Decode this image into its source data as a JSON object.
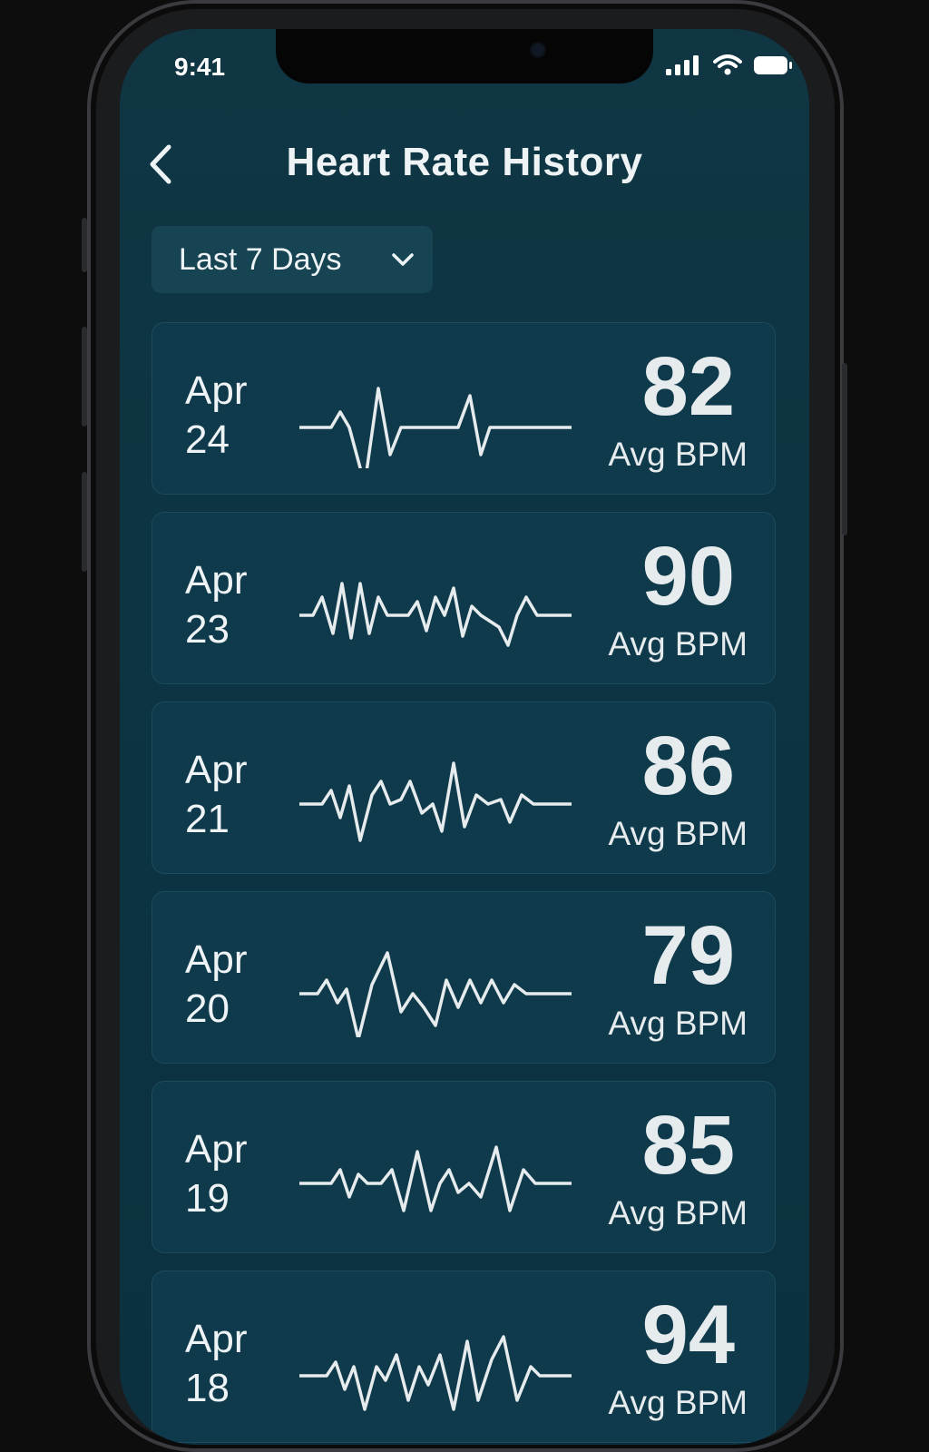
{
  "status_bar": {
    "time": "9:41"
  },
  "header": {
    "title": "Heart Rate History",
    "back_icon": "chevron-left-icon"
  },
  "range_select": {
    "selected": "Last 7 Days",
    "icon": "chevron-down-icon"
  },
  "entries": [
    {
      "month": "Apr",
      "day": "24",
      "bpm": "82",
      "unit": "Avg BPM"
    },
    {
      "month": "Apr",
      "day": "23",
      "bpm": "90",
      "unit": "Avg BPM"
    },
    {
      "month": "Apr",
      "day": "21",
      "bpm": "86",
      "unit": "Avg BPM"
    },
    {
      "month": "Apr",
      "day": "20",
      "bpm": "79",
      "unit": "Avg BPM"
    },
    {
      "month": "Apr",
      "day": "19",
      "bpm": "85",
      "unit": "Avg BPM"
    },
    {
      "month": "Apr",
      "day": "18",
      "bpm": "94",
      "unit": "Avg BPM"
    }
  ],
  "colors": {
    "screen_background": "#0d3442",
    "card_background": "#0f3a4b",
    "text": "#eef3f5",
    "waveform": "#e6ebed"
  }
}
